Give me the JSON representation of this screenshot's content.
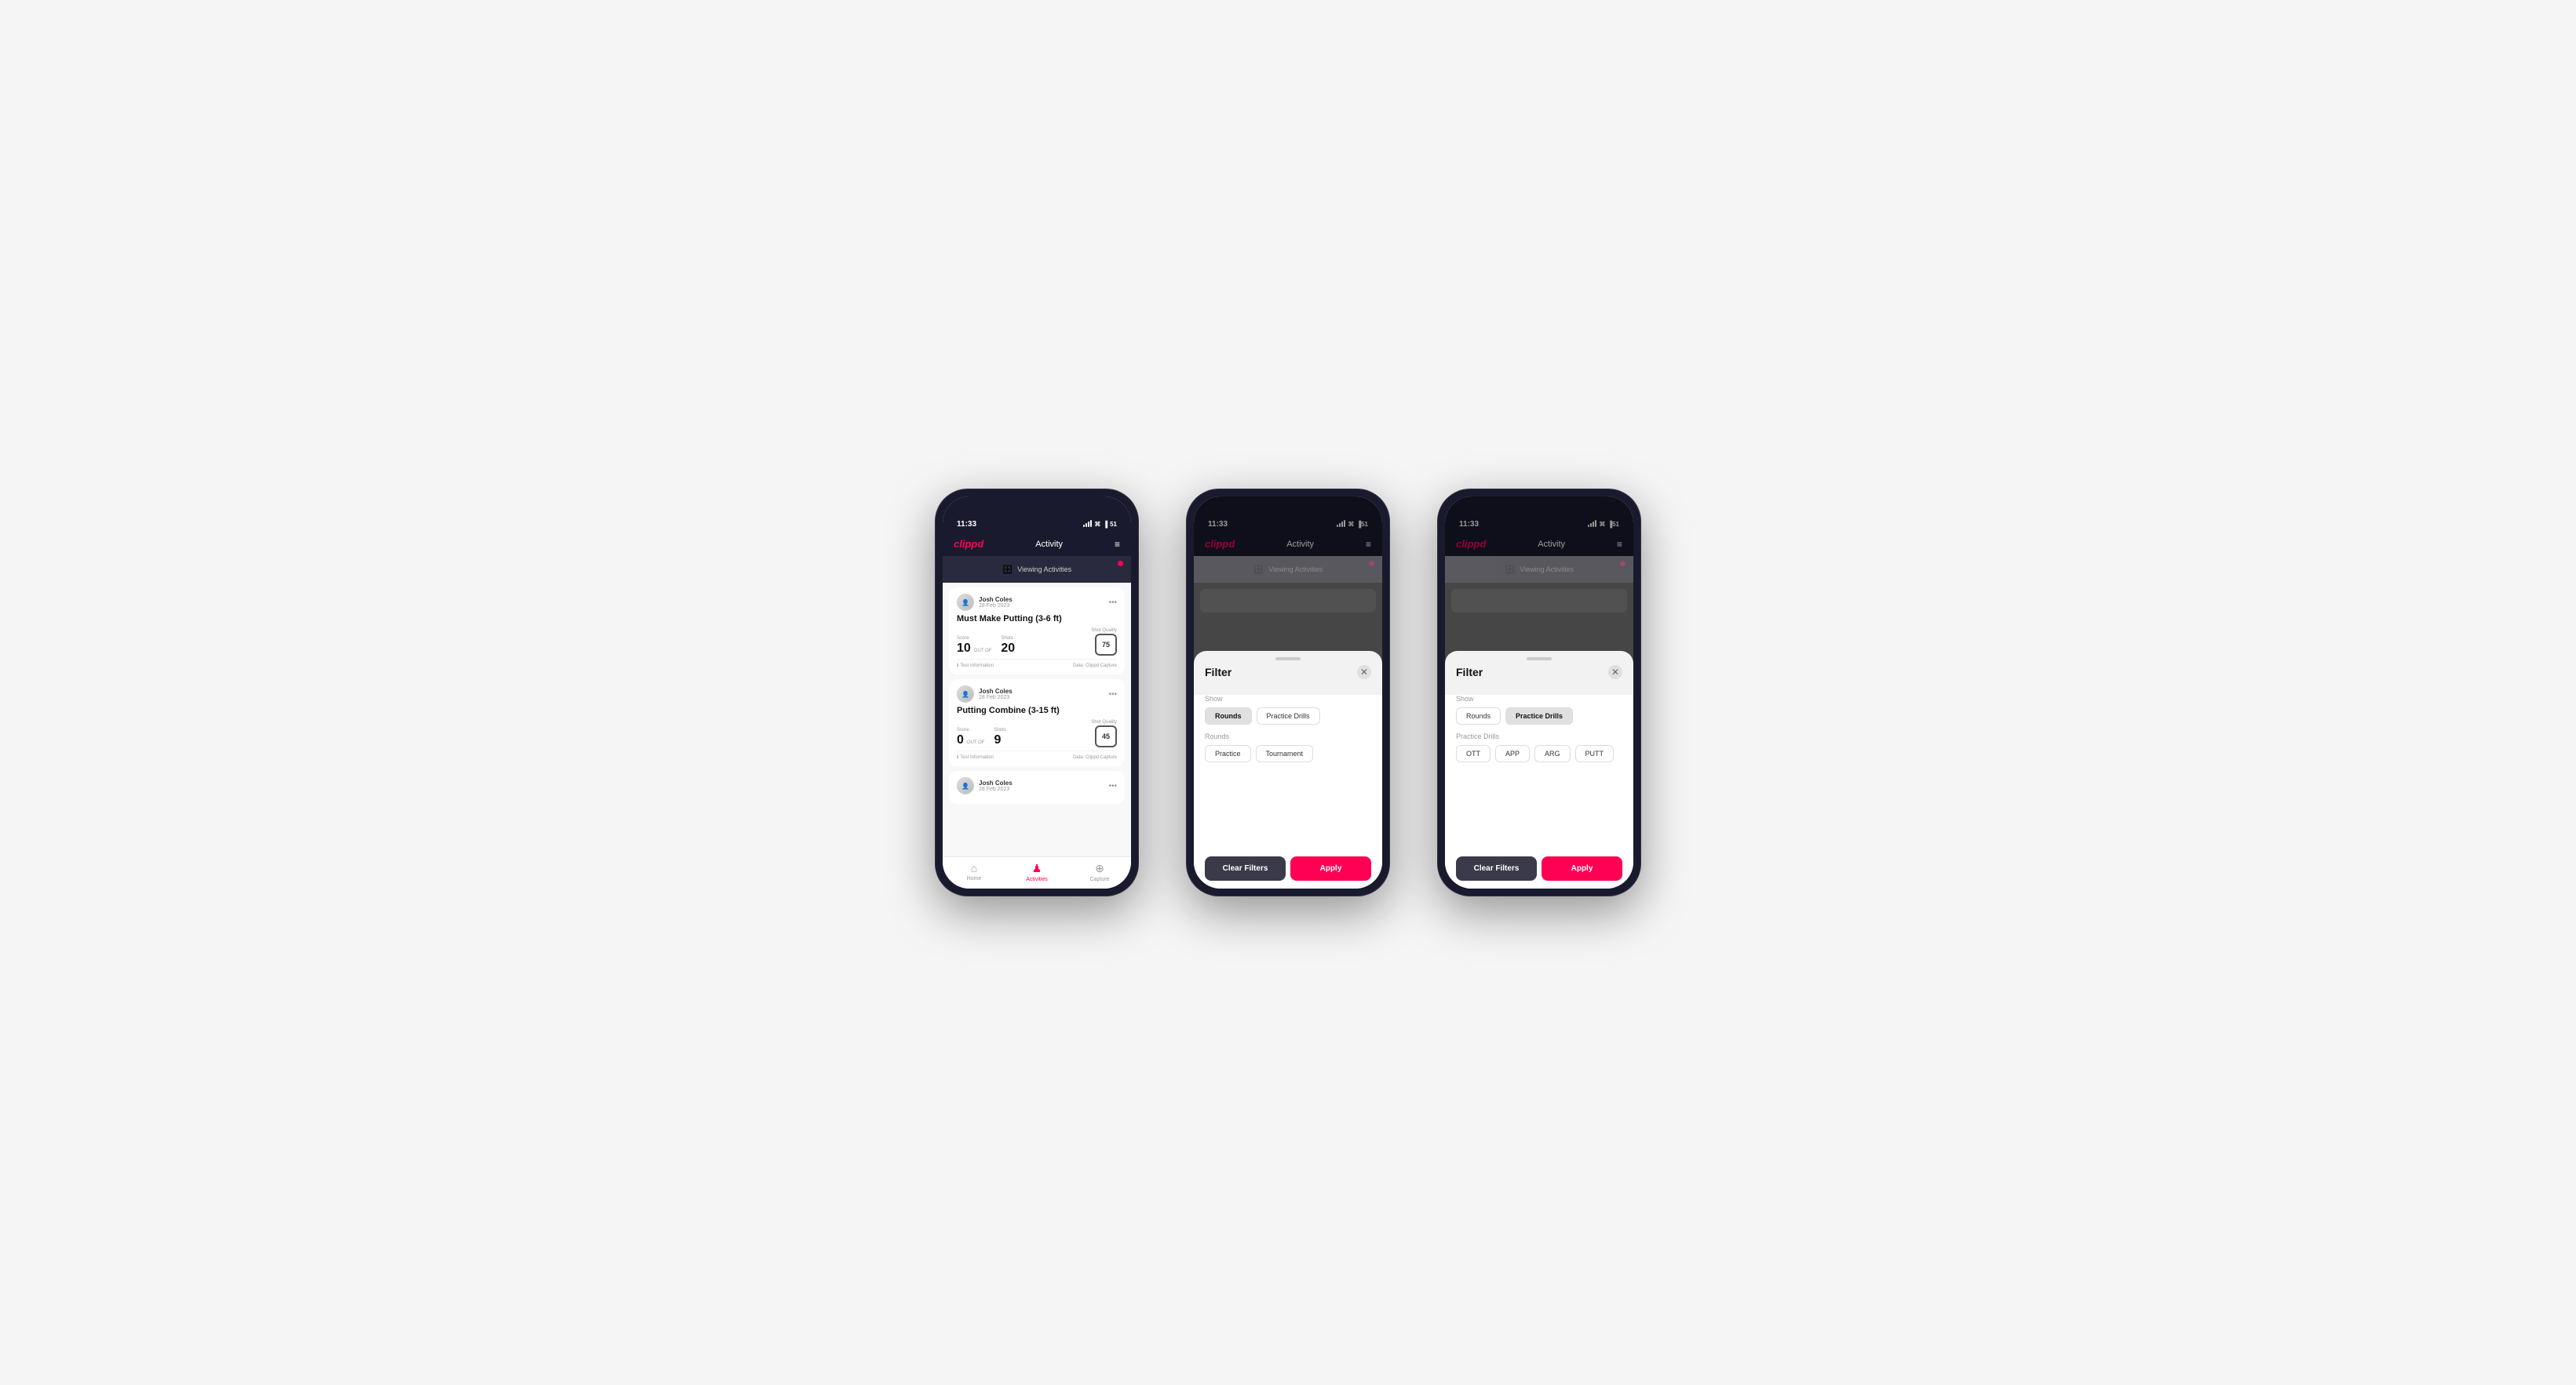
{
  "phone1": {
    "status": {
      "time": "11:33",
      "signal": "●●●",
      "wifi": "WiFi",
      "battery": "51"
    },
    "nav": {
      "logo": "clippd",
      "title": "Activity",
      "menu_icon": "≡"
    },
    "banner": {
      "text": "Viewing Activities"
    },
    "cards": [
      {
        "user_name": "Josh Coles",
        "user_date": "28 Feb 2023",
        "title": "Must Make Putting (3-6 ft)",
        "score_label": "Score",
        "score": "10",
        "out_of_label": "OUT OF",
        "shots_label": "Shots",
        "shots": "20",
        "shot_quality_label": "Shot Quality",
        "shot_quality": "75",
        "info": "Test Information",
        "data_source": "Data: Clippd Capture"
      },
      {
        "user_name": "Josh Coles",
        "user_date": "28 Feb 2023",
        "title": "Putting Combine (3-15 ft)",
        "score_label": "Score",
        "score": "0",
        "out_of_label": "OUT OF",
        "shots_label": "Shots",
        "shots": "9",
        "shot_quality_label": "Shot Quality",
        "shot_quality": "45",
        "info": "Test Information",
        "data_source": "Data: Clippd Capture"
      },
      {
        "user_name": "Josh Coles",
        "user_date": "28 Feb 2023",
        "title": "",
        "score_label": "",
        "score": "",
        "out_of_label": "",
        "shots_label": "",
        "shots": "",
        "shot_quality_label": "",
        "shot_quality": "",
        "info": "",
        "data_source": ""
      }
    ],
    "tabs": [
      {
        "label": "Home",
        "icon": "⌂",
        "active": false
      },
      {
        "label": "Activities",
        "icon": "♟",
        "active": true
      },
      {
        "label": "Capture",
        "icon": "⊕",
        "active": false
      }
    ]
  },
  "phone2": {
    "status": {
      "time": "11:33"
    },
    "nav": {
      "logo": "clippd",
      "title": "Activity",
      "menu_icon": "≡"
    },
    "banner": {
      "text": "Viewing Activities"
    },
    "filter": {
      "title": "Filter",
      "show_label": "Show",
      "show_options": [
        {
          "label": "Rounds",
          "selected": true
        },
        {
          "label": "Practice Drills",
          "selected": false
        }
      ],
      "rounds_label": "Rounds",
      "rounds_options": [
        {
          "label": "Practice",
          "selected": false
        },
        {
          "label": "Tournament",
          "selected": false
        }
      ],
      "clear_label": "Clear Filters",
      "apply_label": "Apply"
    }
  },
  "phone3": {
    "status": {
      "time": "11:33"
    },
    "nav": {
      "logo": "clippd",
      "title": "Activity",
      "menu_icon": "≡"
    },
    "banner": {
      "text": "Viewing Activities"
    },
    "filter": {
      "title": "Filter",
      "show_label": "Show",
      "show_options": [
        {
          "label": "Rounds",
          "selected": false
        },
        {
          "label": "Practice Drills",
          "selected": true
        }
      ],
      "practice_drills_label": "Practice Drills",
      "drill_options": [
        {
          "label": "OTT",
          "selected": false
        },
        {
          "label": "APP",
          "selected": false
        },
        {
          "label": "ARG",
          "selected": false
        },
        {
          "label": "PUTT",
          "selected": false
        }
      ],
      "clear_label": "Clear Filters",
      "apply_label": "Apply"
    }
  }
}
